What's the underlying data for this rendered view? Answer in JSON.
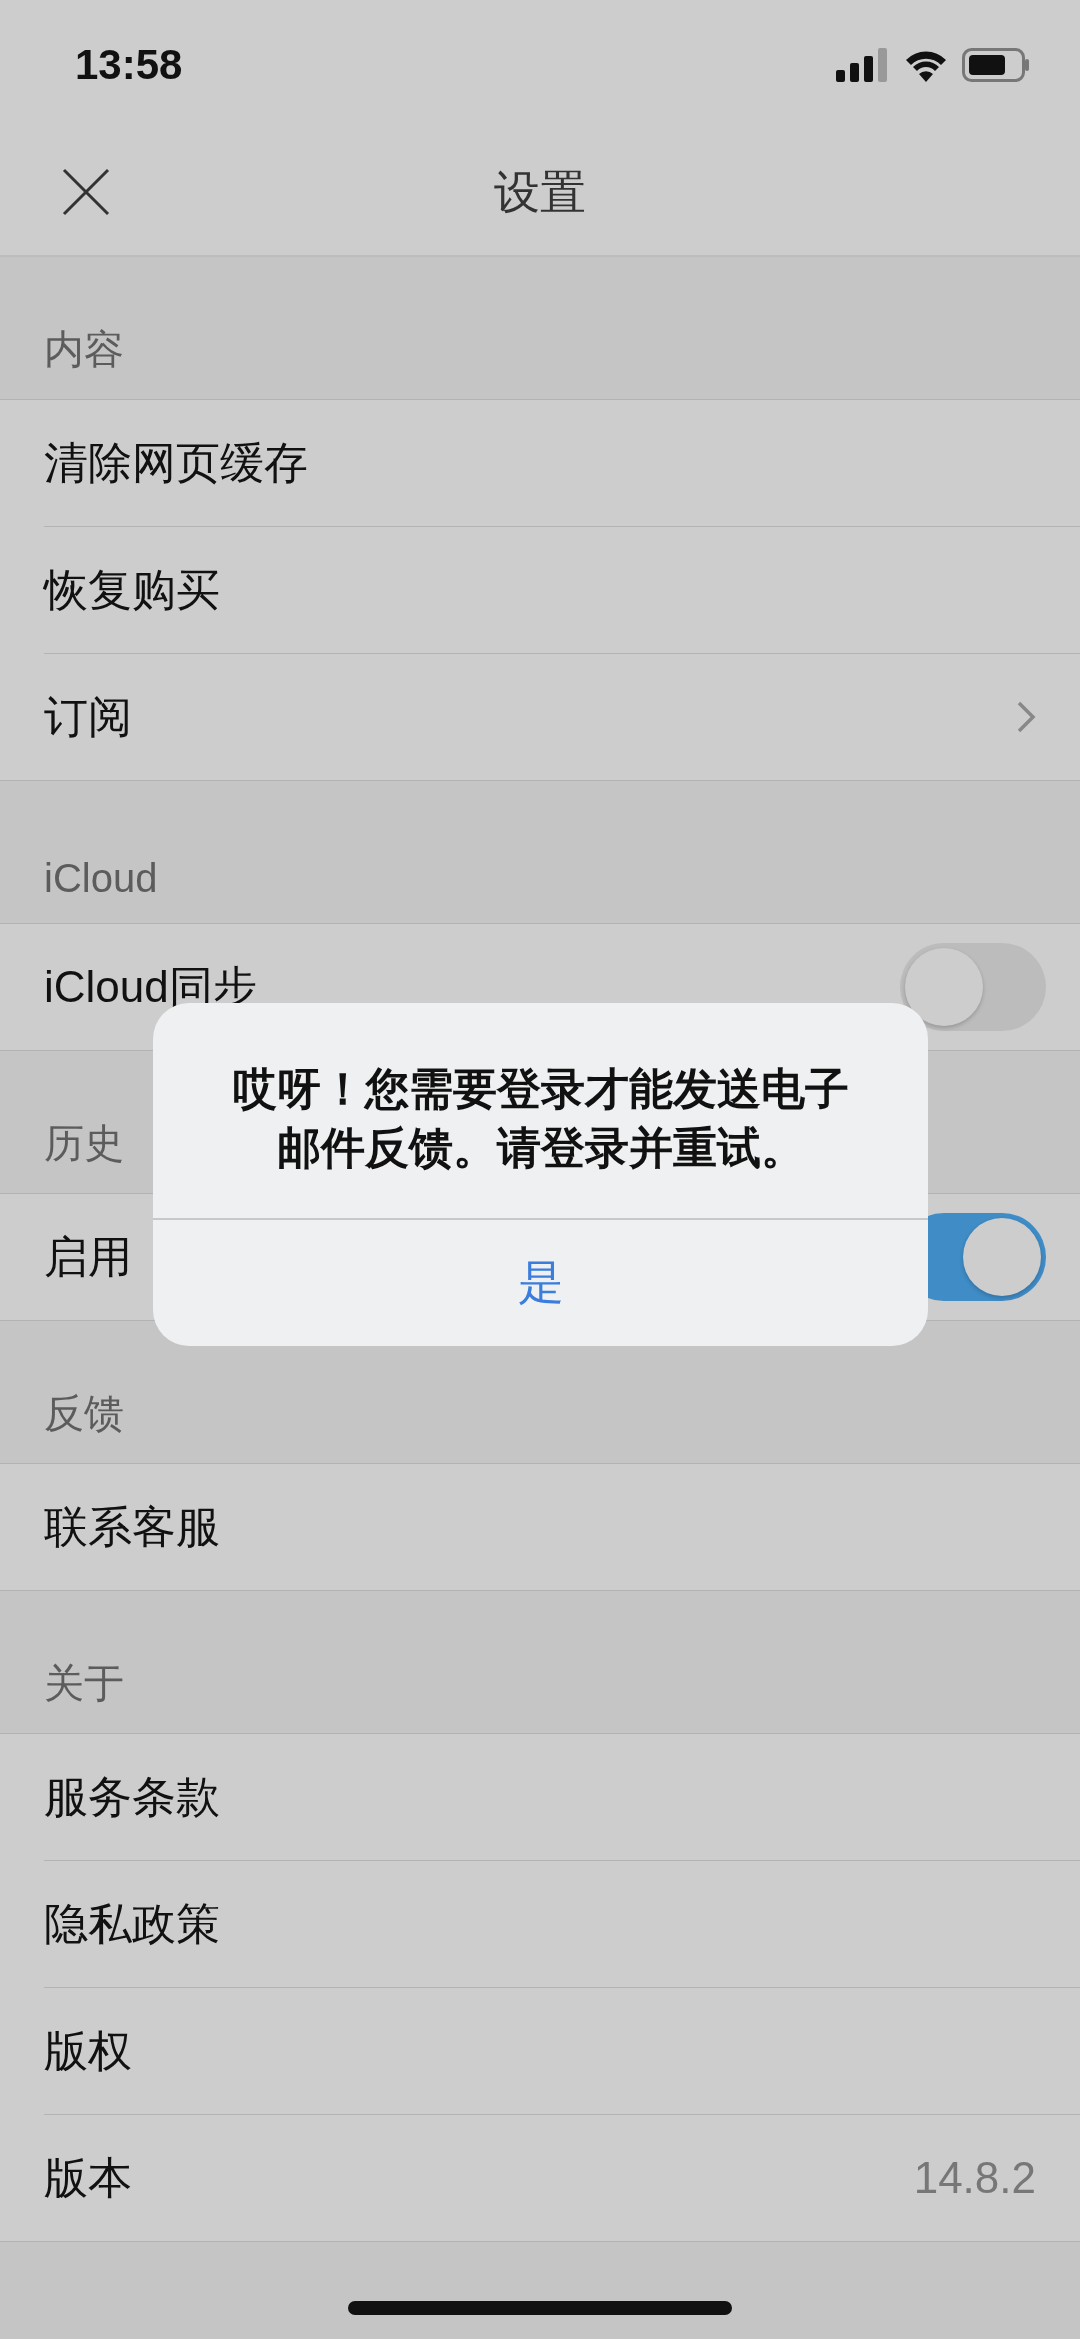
{
  "status_bar": {
    "time": "13:58"
  },
  "nav": {
    "title": "设置"
  },
  "sections": [
    {
      "header": "内容",
      "rows": [
        {
          "label": "清除网页缓存",
          "kind": "action"
        },
        {
          "label": "恢复购买",
          "kind": "action"
        },
        {
          "label": "订阅",
          "kind": "link"
        }
      ]
    },
    {
      "header": "iCloud",
      "rows": [
        {
          "label": "iCloud同步",
          "kind": "toggle",
          "on": false
        }
      ]
    },
    {
      "header": "历史",
      "rows": [
        {
          "label": "启用",
          "kind": "toggle",
          "on": true
        }
      ]
    },
    {
      "header": "反馈",
      "rows": [
        {
          "label": "联系客服",
          "kind": "action"
        }
      ]
    },
    {
      "header": "关于",
      "rows": [
        {
          "label": "服务条款",
          "kind": "action"
        },
        {
          "label": "隐私政策",
          "kind": "action"
        },
        {
          "label": "版权",
          "kind": "action"
        },
        {
          "label": "版本",
          "kind": "value",
          "value": "14.8.2"
        }
      ]
    }
  ],
  "alert": {
    "message": "哎呀！您需要登录才能发送电子邮件反馈。请登录并重试。",
    "button": "是"
  }
}
